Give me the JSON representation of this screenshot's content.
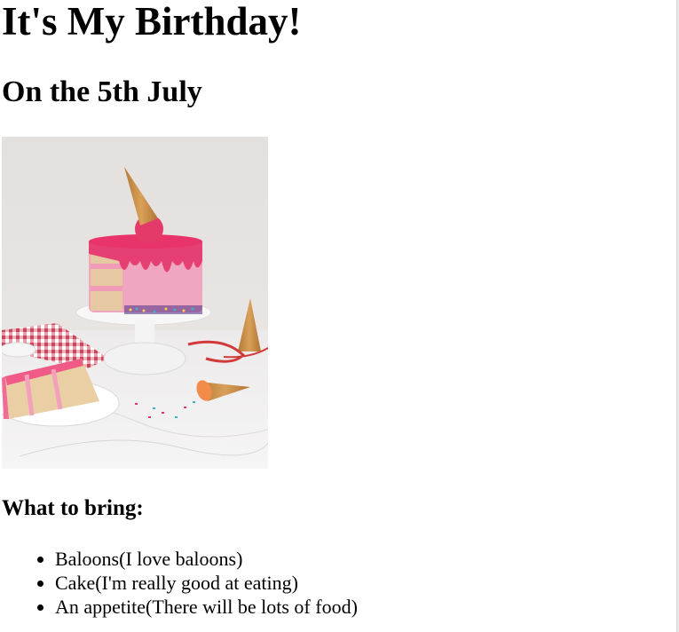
{
  "page": {
    "title": "It's My Birthday!",
    "subtitle": "On the 5th July",
    "image_description_icon": "birthday-cake-image",
    "bring_heading": "What to bring:",
    "bring_items": [
      "Baloons(I love baloons)",
      "Cake(I'm really good at eating)",
      "An appetite(There will be lots of food)"
    ]
  }
}
